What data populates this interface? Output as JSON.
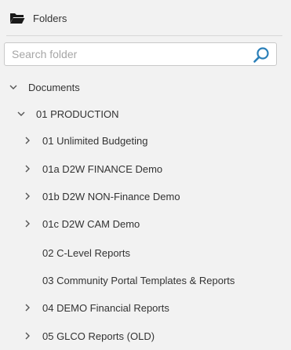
{
  "header": {
    "title": "Folders",
    "icon": "folder-open-icon"
  },
  "search": {
    "placeholder": "Search folder",
    "value": ""
  },
  "tree": {
    "root": {
      "label": "Documents",
      "expanded": true
    },
    "production": {
      "label": "01 PRODUCTION",
      "expanded": true
    },
    "items": [
      {
        "label": "01 Unlimited Budgeting",
        "expandable": true
      },
      {
        "label": "01a D2W FINANCE Demo",
        "expandable": true
      },
      {
        "label": "01b D2W NON-Finance Demo",
        "expandable": true
      },
      {
        "label": "01c D2W CAM Demo",
        "expandable": true
      },
      {
        "label": "02 C-Level Reports",
        "expandable": false
      },
      {
        "label": "03 Community Portal Templates & Reports",
        "expandable": false
      },
      {
        "label": "04 DEMO Financial Reports",
        "expandable": true
      },
      {
        "label": "05 GLCO Reports (OLD)",
        "expandable": true
      }
    ]
  },
  "colors": {
    "background": "#f2f2f2",
    "accent": "#2a7fb8",
    "text": "#333333"
  }
}
